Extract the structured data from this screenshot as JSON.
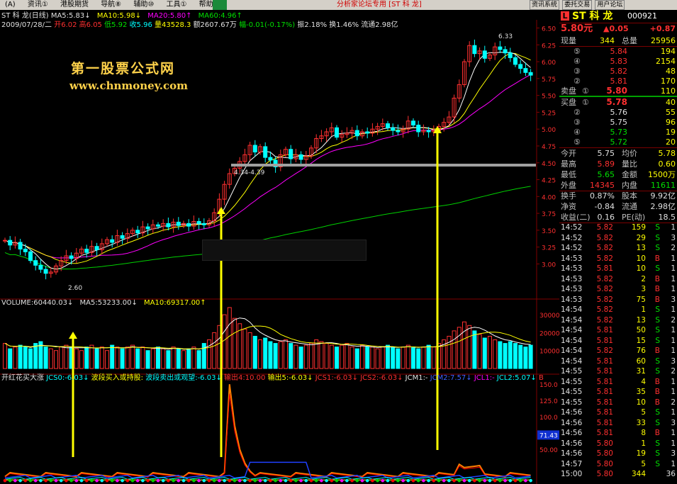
{
  "menu": {
    "items": [
      "(A)",
      "资讯①",
      "港股期货",
      "导航⑧",
      "辅助⑩",
      "工具①",
      "帮助④"
    ],
    "page_title": "分析家论坛专用 [ST 科 龙]"
  },
  "top_buttons": [
    "资讯系统",
    "委托交易",
    "用户论坛"
  ],
  "title": {
    "stock": "ST 科 龙(日线)",
    "ma5": "MA5:5.83↓",
    "ma10": "MA10:5.98↓",
    "ma20": "MA20:5.80↑",
    "ma60": "MA60:4.96↑",
    "info_date": "2009/07/28/二",
    "info_open": "开6.02",
    "info_high": "高6.05",
    "info_low": "低5.92",
    "info_close": "收5.96",
    "info_vol": "量43528.3",
    "info_amt": "额2607.67万",
    "info_chg": "幅-0.01(-0.17%)",
    "info_rest": "振2.18% 换1.46% 流通2.98亿"
  },
  "watermark": {
    "line1": "第一股票公式网",
    "line2": "www.chnmoney.com"
  },
  "annotations": {
    "high": "6.33",
    "range": "4.34-4.39",
    "low": "2.60"
  },
  "volume_title": {
    "vol": "VOLUME:60440.03↓",
    "ma5": "MA5:53233.00↓",
    "ma10": "MA10:69317.00↑"
  },
  "indicator_title": {
    "name": "开红花买大涨",
    "jcs0": "JCS0:-6.03↓",
    "buy": "波段买入或持股:",
    "sell": "波段卖出或观望:-6.03↓",
    "in": "输出4:10.00",
    "out5": "输出5:-6.03↓",
    "jcs1": "JCS1:-6.03↓",
    "jcs2": "JCS2:-6.03↓",
    "jcm1": "JCM1:-",
    "jcm2": "JCM2:7.57↓",
    "jcl1": "JCL1:-",
    "jcl2": "JCL2:5.07↓",
    "b": "B"
  },
  "axis": {
    "price": [
      "6.50",
      "6.25",
      "6.00",
      "5.75",
      "5.50",
      "5.25",
      "5.00",
      "4.75",
      "4.50",
      "4.25",
      "4.00",
      "3.75",
      "3.50",
      "3.25",
      "3.00"
    ],
    "vol": [
      "30000",
      "20000",
      "10000"
    ],
    "ind": [
      "150.0",
      "125.0",
      "100.0",
      "75.00",
      "50.00"
    ],
    "ind_badge": "71.43"
  },
  "colors": {
    "up": "#ff3030",
    "down": "#00ffff",
    "ma5": "#ffffff",
    "ma10": "#ffff00",
    "ma20": "#ff00ff",
    "ma60": "#00d000"
  },
  "chart_data": {
    "type": "candlestick",
    "closes": [
      3.35,
      3.28,
      3.32,
      3.22,
      3.18,
      3.05,
      2.98,
      2.92,
      2.86,
      2.88,
      2.97,
      3.05,
      3.12,
      3.08,
      3.16,
      3.22,
      3.17,
      3.26,
      3.21,
      3.3,
      3.36,
      3.32,
      3.42,
      3.38,
      3.45,
      3.5,
      3.46,
      3.55,
      3.52,
      3.58,
      3.56,
      3.6,
      3.55,
      3.62,
      3.57,
      3.6,
      3.56,
      3.63,
      3.6,
      3.58,
      3.64,
      3.76,
      3.96,
      4.18,
      4.34,
      4.42,
      4.52,
      4.62,
      4.76,
      4.66,
      4.74,
      4.58,
      4.54,
      4.44,
      4.62,
      4.7,
      4.56,
      4.62,
      4.55,
      4.6,
      4.72,
      4.86,
      4.9,
      4.96,
      5.02,
      4.88,
      4.92,
      4.94,
      4.98,
      4.9,
      4.96,
      4.94,
      5.0,
      5.04,
      5.08,
      5.02,
      4.98,
      4.96,
      5.0,
      5.12,
      5.06,
      4.96,
      4.98,
      4.96,
      4.98,
      5.04,
      5.1,
      5.18,
      5.46,
      5.66,
      6.0,
      6.24,
      6.12,
      6.16,
      6.05,
      6.1,
      6.22,
      6.18,
      6.13,
      6.06,
      5.96,
      5.9,
      5.84,
      5.8
    ],
    "volumes": [
      14,
      11,
      12,
      13,
      12,
      11,
      14,
      15,
      12,
      11,
      10,
      12,
      13,
      12,
      11,
      10,
      12,
      13,
      11,
      12,
      10,
      13,
      12,
      11,
      12,
      13,
      11,
      12,
      10,
      11,
      12,
      11,
      10,
      12,
      11,
      10,
      11,
      12,
      10,
      14,
      16,
      20,
      24,
      30,
      34,
      28,
      25,
      22,
      20,
      18,
      16,
      17,
      15,
      14,
      15,
      16,
      14,
      13,
      12,
      13,
      14,
      16,
      15,
      14,
      13,
      12,
      13,
      14,
      12,
      11,
      13,
      12,
      12,
      11,
      12,
      13,
      12,
      11,
      12,
      13,
      12,
      11,
      12,
      13,
      12,
      14,
      16,
      18,
      21,
      23,
      26,
      24,
      21,
      19,
      17,
      18,
      16,
      15,
      14,
      15,
      14,
      13,
      12,
      13
    ],
    "ylim": [
      2.5,
      6.6
    ]
  },
  "quote": {
    "logo": "L",
    "name": "ST 科 龙",
    "code": "000921",
    "price": "5.80元",
    "chg": "▲0.05",
    "chg_pct": "+0.87",
    "now_label": "现量",
    "now": "344",
    "total_label": "总量",
    "total": "25956",
    "asks": [
      {
        "n": "⑤",
        "p": "5.84",
        "v": "194"
      },
      {
        "n": "④",
        "p": "5.83",
        "v": "2154"
      },
      {
        "n": "③",
        "p": "5.82",
        "v": "48"
      },
      {
        "n": "②",
        "p": "5.81",
        "v": "170"
      },
      {
        "n": "①",
        "p": "5.80",
        "v": "110"
      }
    ],
    "ask_label": "卖盘",
    "bid_label": "买盘",
    "bids": [
      {
        "n": "①",
        "p": "5.78",
        "v": "40"
      },
      {
        "n": "②",
        "p": "5.76",
        "v": "55"
      },
      {
        "n": "③",
        "p": "5.75",
        "v": "96"
      },
      {
        "n": "④",
        "p": "5.73",
        "v": "19"
      },
      {
        "n": "⑤",
        "p": "5.72",
        "v": "20"
      }
    ],
    "stats": [
      {
        "l1": "今开",
        "v1": "5.75",
        "l2": "均价",
        "v2": "5.78"
      },
      {
        "l1": "最高",
        "v1": "5.89",
        "l2": "量比",
        "v2": "0.60"
      },
      {
        "l1": "最低",
        "v1": "5.65",
        "l2": "金额",
        "v2": "1500万"
      },
      {
        "l1": "外盘",
        "v1": "14345",
        "l2": "内盘",
        "v2": "11611"
      }
    ],
    "stats2": [
      {
        "l1": "换手",
        "v1": "0.87%",
        "l2": "股本",
        "v2": "9.92亿"
      },
      {
        "l1": "净资",
        "v1": "-0.84",
        "l2": "流通",
        "v2": "2.98亿"
      },
      {
        "l1": "收益(二)",
        "v1": "0.16",
        "l2": "PE(动)",
        "v2": "18.5"
      }
    ],
    "ticks": [
      {
        "t": "14:52",
        "p": "5.82",
        "v": "159",
        "s": "S",
        "n": "1"
      },
      {
        "t": "14:52",
        "p": "5.82",
        "v": "29",
        "s": "S",
        "n": "3"
      },
      {
        "t": "14:52",
        "p": "5.82",
        "v": "13",
        "s": "S",
        "n": "2"
      },
      {
        "t": "14:53",
        "p": "5.82",
        "v": "10",
        "s": "B",
        "n": "1"
      },
      {
        "t": "14:53",
        "p": "5.81",
        "v": "10",
        "s": "S",
        "n": "1"
      },
      {
        "t": "14:53",
        "p": "5.82",
        "v": "2",
        "s": "B",
        "n": "1"
      },
      {
        "t": "14:53",
        "p": "5.82",
        "v": "3",
        "s": "B",
        "n": "1"
      },
      {
        "t": "14:53",
        "p": "5.82",
        "v": "75",
        "s": "B",
        "n": "3"
      },
      {
        "t": "14:54",
        "p": "5.82",
        "v": "1",
        "s": "S",
        "n": "1"
      },
      {
        "t": "14:54",
        "p": "5.82",
        "v": "13",
        "s": "S",
        "n": "2"
      },
      {
        "t": "14:54",
        "p": "5.81",
        "v": "50",
        "s": "S",
        "n": "1"
      },
      {
        "t": "14:54",
        "p": "5.81",
        "v": "15",
        "s": "S",
        "n": "1"
      },
      {
        "t": "14:54",
        "p": "5.82",
        "v": "76",
        "s": "B",
        "n": "1"
      },
      {
        "t": "14:54",
        "p": "5.81",
        "v": "60",
        "s": "S",
        "n": "3"
      },
      {
        "t": "14:55",
        "p": "5.81",
        "v": "31",
        "s": "S",
        "n": "2"
      },
      {
        "t": "14:55",
        "p": "5.81",
        "v": "4",
        "s": "B",
        "n": "1"
      },
      {
        "t": "14:55",
        "p": "5.81",
        "v": "35",
        "s": "B",
        "n": "1"
      },
      {
        "t": "14:55",
        "p": "5.81",
        "v": "10",
        "s": "B",
        "n": "2"
      },
      {
        "t": "14:56",
        "p": "5.81",
        "v": "5",
        "s": "S",
        "n": "1"
      },
      {
        "t": "14:56",
        "p": "5.81",
        "v": "33",
        "s": "S",
        "n": "3"
      },
      {
        "t": "14:56",
        "p": "5.81",
        "v": "8",
        "s": "B",
        "n": "1"
      },
      {
        "t": "14:56",
        "p": "5.80",
        "v": "1",
        "s": "S",
        "n": "1"
      },
      {
        "t": "14:56",
        "p": "5.80",
        "v": "19",
        "s": "S",
        "n": "3"
      },
      {
        "t": "14:57",
        "p": "5.80",
        "v": "5",
        "s": "S",
        "n": "1"
      },
      {
        "t": "15:00",
        "p": "5.80",
        "v": "344",
        "s": "",
        "n": "36"
      }
    ]
  }
}
